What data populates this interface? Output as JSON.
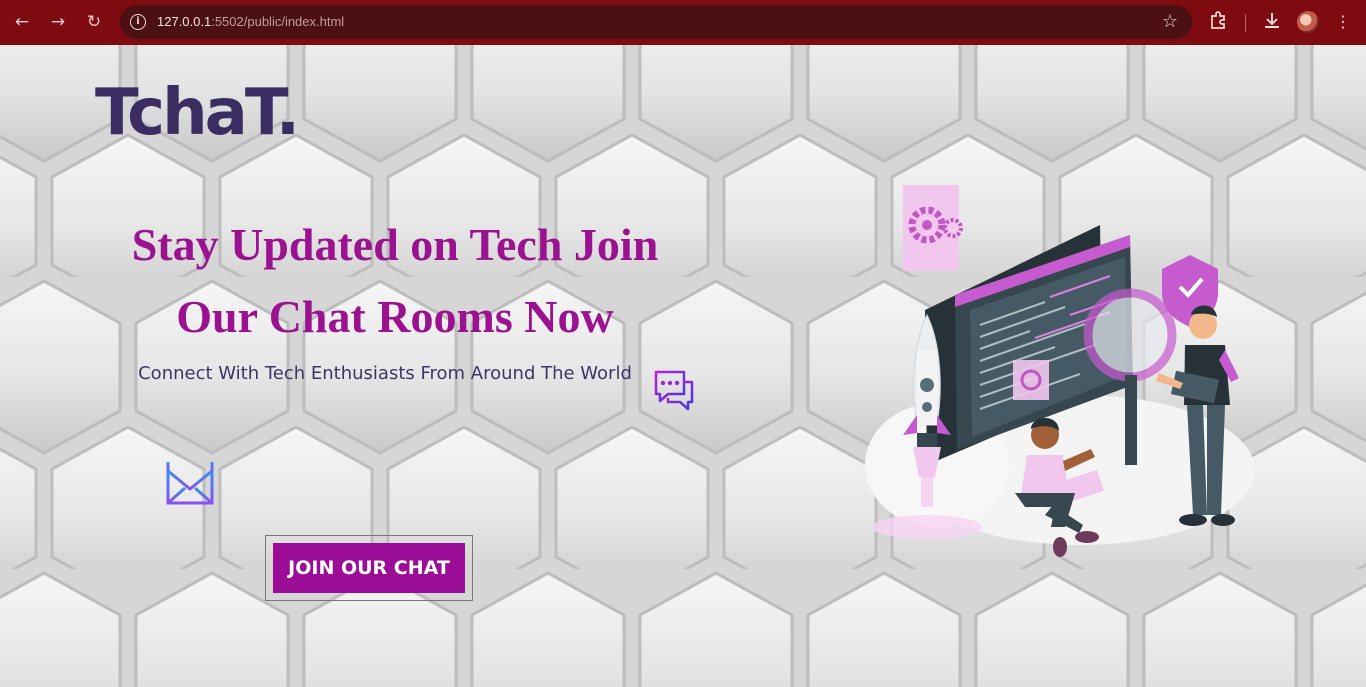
{
  "browser": {
    "url_host": "127.0.0.1",
    "url_rest": ":5502/public/index.html",
    "icons": [
      "back-icon",
      "forward-icon",
      "reload-icon",
      "site-info-icon",
      "bookmark-star-icon",
      "extensions-icon",
      "download-icon",
      "profile-avatar",
      "menu-icon"
    ]
  },
  "page": {
    "logo": "TchaT.",
    "headline": "Stay Updated on Tech Join Our Chat Rooms Now",
    "subheadline": "Connect With Tech Enthusiasts From Around The World",
    "cta_label": "JOIN OUR CHAT",
    "icons": [
      "chat-bubbles-icon",
      "mail-icon",
      "tech-illustration"
    ]
  },
  "colors": {
    "chrome": "#7d0b10",
    "omnibox": "#4b1012",
    "accent": "#9b0d96",
    "heading": "#9b1290",
    "logo": "#3a2d62",
    "subtext": "#3d3565"
  }
}
